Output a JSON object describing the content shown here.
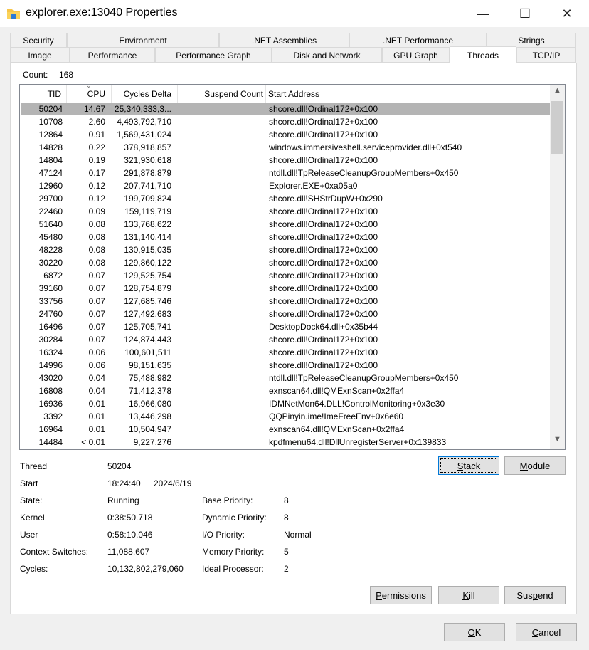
{
  "window": {
    "title": "explorer.exe:13040 Properties",
    "controls": {
      "minimize": "—",
      "maximize": "☐",
      "close": "✕"
    }
  },
  "tabs": {
    "row1": [
      "Security",
      "Environment",
      ".NET Assemblies",
      ".NET Performance",
      "Strings"
    ],
    "row2": [
      "Image",
      "Performance",
      "Performance Graph",
      "Disk and Network",
      "GPU Graph",
      "Threads",
      "TCP/IP"
    ],
    "active": "Threads"
  },
  "threads": {
    "count_label": "Count:",
    "count": "168",
    "columns": [
      "TID",
      "CPU",
      "Cycles Delta",
      "Suspend Count",
      "Start Address"
    ],
    "sort_column": "CPU",
    "sort_direction": "descending",
    "selected_index": 0,
    "rows": [
      [
        "50204",
        "14.67",
        "25,340,333,3...",
        "",
        "shcore.dll!Ordinal172+0x100"
      ],
      [
        "10708",
        "2.60",
        "4,493,792,710",
        "",
        "shcore.dll!Ordinal172+0x100"
      ],
      [
        "12864",
        "0.91",
        "1,569,431,024",
        "",
        "shcore.dll!Ordinal172+0x100"
      ],
      [
        "14828",
        "0.22",
        "378,918,857",
        "",
        "windows.immersiveshell.serviceprovider.dll+0xf540"
      ],
      [
        "14804",
        "0.19",
        "321,930,618",
        "",
        "shcore.dll!Ordinal172+0x100"
      ],
      [
        "47124",
        "0.17",
        "291,878,879",
        "",
        "ntdll.dll!TpReleaseCleanupGroupMembers+0x450"
      ],
      [
        "12960",
        "0.12",
        "207,741,710",
        "",
        "Explorer.EXE+0xa05a0"
      ],
      [
        "29700",
        "0.12",
        "199,709,824",
        "",
        "shcore.dll!SHStrDupW+0x290"
      ],
      [
        "22460",
        "0.09",
        "159,119,719",
        "",
        "shcore.dll!Ordinal172+0x100"
      ],
      [
        "51640",
        "0.08",
        "133,768,622",
        "",
        "shcore.dll!Ordinal172+0x100"
      ],
      [
        "45480",
        "0.08",
        "131,140,414",
        "",
        "shcore.dll!Ordinal172+0x100"
      ],
      [
        "48228",
        "0.08",
        "130,915,035",
        "",
        "shcore.dll!Ordinal172+0x100"
      ],
      [
        "30220",
        "0.08",
        "129,860,122",
        "",
        "shcore.dll!Ordinal172+0x100"
      ],
      [
        "6872",
        "0.07",
        "129,525,754",
        "",
        "shcore.dll!Ordinal172+0x100"
      ],
      [
        "39160",
        "0.07",
        "128,754,879",
        "",
        "shcore.dll!Ordinal172+0x100"
      ],
      [
        "33756",
        "0.07",
        "127,685,746",
        "",
        "shcore.dll!Ordinal172+0x100"
      ],
      [
        "24760",
        "0.07",
        "127,492,683",
        "",
        "shcore.dll!Ordinal172+0x100"
      ],
      [
        "16496",
        "0.07",
        "125,705,741",
        "",
        "DesktopDock64.dll+0x35b44"
      ],
      [
        "30284",
        "0.07",
        "124,874,443",
        "",
        "shcore.dll!Ordinal172+0x100"
      ],
      [
        "16324",
        "0.06",
        "100,601,511",
        "",
        "shcore.dll!Ordinal172+0x100"
      ],
      [
        "14996",
        "0.06",
        "98,151,635",
        "",
        "shcore.dll!Ordinal172+0x100"
      ],
      [
        "43020",
        "0.04",
        "75,488,982",
        "",
        "ntdll.dll!TpReleaseCleanupGroupMembers+0x450"
      ],
      [
        "16808",
        "0.04",
        "71,412,378",
        "",
        "exnscan64.dll!QMExnScan+0x2ffa4"
      ],
      [
        "16936",
        "0.01",
        "16,966,080",
        "",
        "IDMNetMon64.DLL!ControlMonitoring+0x3e30"
      ],
      [
        "3392",
        "0.01",
        "13,446,298",
        "",
        "QQPinyin.ime!ImeFreeEnv+0x6e60"
      ],
      [
        "16964",
        "0.01",
        "10,504,947",
        "",
        "exnscan64.dll!QMExnScan+0x2ffa4"
      ],
      [
        "14484",
        "< 0.01",
        "9,227,276",
        "",
        "kpdfmenu64.dll!DllUnregisterServer+0x139833"
      ]
    ]
  },
  "details": {
    "thread": {
      "label": "Thread",
      "value": "50204"
    },
    "start": {
      "label": "Start",
      "time": "18:24:40",
      "date": "2024/6/19"
    },
    "state": {
      "label": "State:",
      "value": "Running"
    },
    "kernel": {
      "label": "Kernel",
      "value": "0:38:50.718"
    },
    "user": {
      "label": "User",
      "value": "0:58:10.046"
    },
    "context_switches": {
      "label": "Context Switches:",
      "value": "11,088,607"
    },
    "cycles": {
      "label": "Cycles:",
      "value": "10,132,802,279,060"
    },
    "base_priority": {
      "label": "Base Priority:",
      "value": "8"
    },
    "dynamic_priority": {
      "label": "Dynamic Priority:",
      "value": "8"
    },
    "io_priority": {
      "label": "I/O Priority:",
      "value": "Normal"
    },
    "memory_priority": {
      "label": "Memory Priority:",
      "value": "5"
    },
    "ideal_processor": {
      "label": "Ideal Processor:",
      "value": "2"
    }
  },
  "buttons": {
    "stack": {
      "label": "Stack",
      "mnemonic": 0
    },
    "module": {
      "label": "Module",
      "mnemonic": 0
    },
    "permissions": {
      "label": "Permissions",
      "mnemonic": 0
    },
    "kill": {
      "label": "Kill",
      "mnemonic": 0
    },
    "suspend": {
      "label": "Suspend",
      "mnemonic": 3
    },
    "ok": {
      "label": "OK",
      "mnemonic": 0
    },
    "cancel": {
      "label": "Cancel",
      "mnemonic": 0
    }
  },
  "colors": {
    "selected_row": "#b4b4b4",
    "focus_border": "#0078d7",
    "folder": "#f7c548"
  }
}
